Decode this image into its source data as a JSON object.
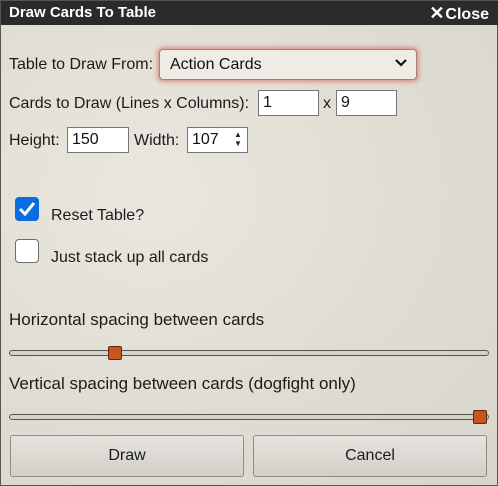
{
  "dialog": {
    "title": "Draw Cards To Table",
    "close_label": "Close"
  },
  "form": {
    "table_label": "Table to Draw From:",
    "table_selected": "Action Cards",
    "cards_label": "Cards to Draw (Lines x Columns):",
    "lines_value": "1",
    "x_sep": "x",
    "columns_value": "9",
    "height_label": "Height:",
    "height_value": "150",
    "width_label": "Width:",
    "width_value": "107",
    "reset_label": "Reset Table?",
    "reset_checked": true,
    "stack_label": "Just stack up all cards",
    "stack_checked": false
  },
  "sliders": {
    "horizontal_label": "Horizontal spacing between cards",
    "horizontal_fraction": 0.21,
    "vertical_label": "Vertical spacing between cards (dogfight only)",
    "vertical_fraction": 1.0
  },
  "buttons": {
    "draw": "Draw",
    "cancel": "Cancel"
  },
  "colors": {
    "accent": "#0a6ce0",
    "slider_thumb": "#c9541d",
    "title_bar": "#2b2b2b"
  }
}
